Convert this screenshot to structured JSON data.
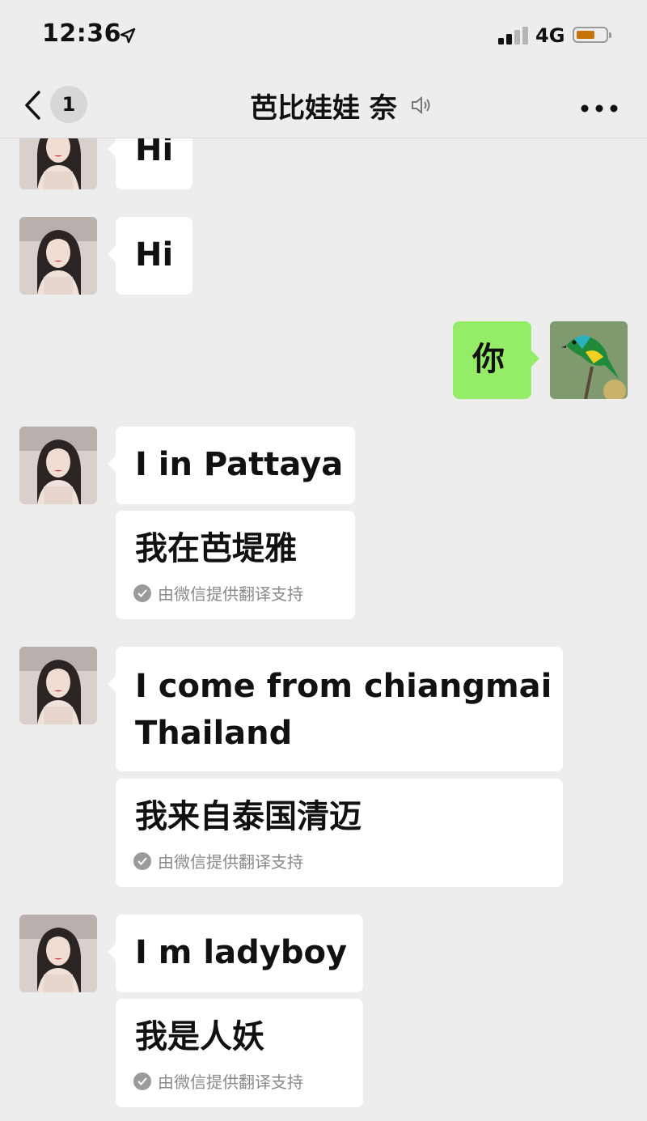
{
  "status_bar": {
    "time": "12:36",
    "network": "4G"
  },
  "header": {
    "back_badge": "1",
    "title": "芭比娃娃 奈"
  },
  "messages": {
    "m1": {
      "text": "Hi"
    },
    "m2": {
      "text": "Hi"
    },
    "m3": {
      "text": "你"
    },
    "m4": {
      "text": "I in Pattaya",
      "translation": "我在芭堤雅",
      "note": "由微信提供翻译支持"
    },
    "m5": {
      "text_line1": "I come from chiangmai",
      "text_line2": "Thailand",
      "translation": "我来自泰国清迈",
      "note": "由微信提供翻译支持"
    },
    "m6": {
      "text": "I m ladyboy",
      "translation": "我是人妖",
      "note": "由微信提供翻译支持"
    }
  },
  "colors": {
    "background": "#ededed",
    "bubble_self": "#95ec69",
    "bubble_other": "#ffffff",
    "battery": "#c8740a"
  },
  "icons": [
    "location-arrow-icon",
    "signal-icon",
    "battery-icon",
    "back-chevron-icon",
    "mute-icon",
    "more-icon",
    "check-icon"
  ]
}
